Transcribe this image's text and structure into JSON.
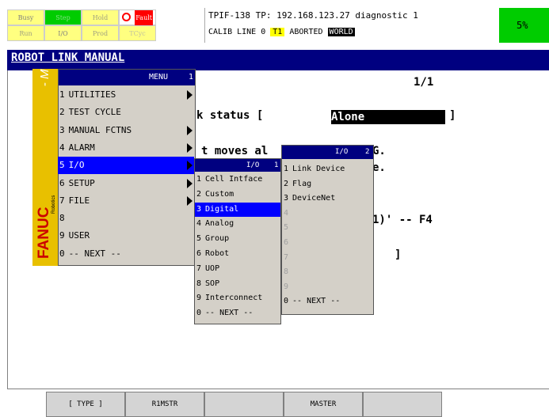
{
  "status_lamps": {
    "busy": "Busy",
    "step": "Step",
    "hold": "Hold",
    "fault": "Fault",
    "run": "Run",
    "io": "I/O",
    "prod": "Prod",
    "tcyc": "TCyc"
  },
  "status_line1": "TPIF-138 TP: 192.168.123.27 diagnostic 1",
  "status_line2": {
    "prefix": "CALIB LINE 0",
    "t1": "T1",
    "aborted": "ABORTED",
    "world": "WORLD"
  },
  "override": "5%",
  "screen_title": "ROBOT LINK MANUAL",
  "page_indicator": "1/1",
  "background_text": {
    "link_status_label": "k status [",
    "link_status_value": "Alone",
    "link_status_close": "]",
    "line2": "t moves al",
    "line2_tail": "G.",
    "line3_tail": "e.",
    "line4": "1)' -- F4",
    "line5": "]"
  },
  "side_brand": {
    "menus_label": "- Menus -",
    "logo": "FANUC",
    "logo_sub": "Robotics"
  },
  "main_menu": {
    "title": "MENU",
    "page": "1",
    "items": [
      {
        "num": "1",
        "label": "UTILITIES",
        "has_sub": true,
        "selected": false
      },
      {
        "num": "2",
        "label": "TEST CYCLE",
        "has_sub": false,
        "selected": false
      },
      {
        "num": "3",
        "label": "MANUAL FCTNS",
        "has_sub": true,
        "selected": false
      },
      {
        "num": "4",
        "label": "ALARM",
        "has_sub": true,
        "selected": false
      },
      {
        "num": "5",
        "label": "I/O",
        "has_sub": true,
        "selected": true
      },
      {
        "num": "6",
        "label": "SETUP",
        "has_sub": true,
        "selected": false
      },
      {
        "num": "7",
        "label": "FILE",
        "has_sub": true,
        "selected": false
      },
      {
        "num": "8",
        "label": "",
        "has_sub": false,
        "selected": false
      },
      {
        "num": "9",
        "label": "USER",
        "has_sub": false,
        "selected": false
      },
      {
        "num": "0",
        "label": "-- NEXT --",
        "has_sub": false,
        "selected": false
      }
    ]
  },
  "io_menu": {
    "title": "I/O",
    "page": "1",
    "items": [
      {
        "num": "1",
        "label": "Cell Intface",
        "selected": false,
        "disabled": false
      },
      {
        "num": "2",
        "label": "Custom",
        "selected": false,
        "disabled": false
      },
      {
        "num": "3",
        "label": "Digital",
        "selected": true,
        "disabled": false
      },
      {
        "num": "4",
        "label": "Analog",
        "selected": false,
        "disabled": false
      },
      {
        "num": "5",
        "label": "Group",
        "selected": false,
        "disabled": false
      },
      {
        "num": "6",
        "label": "Robot",
        "selected": false,
        "disabled": false
      },
      {
        "num": "7",
        "label": "UOP",
        "selected": false,
        "disabled": false
      },
      {
        "num": "8",
        "label": "SOP",
        "selected": false,
        "disabled": false
      },
      {
        "num": "9",
        "label": "Interconnect",
        "selected": false,
        "disabled": false
      },
      {
        "num": "0",
        "label": "-- NEXT --",
        "selected": false,
        "disabled": false
      }
    ]
  },
  "io2_menu": {
    "title": "I/O",
    "page": "2",
    "items": [
      {
        "num": "1",
        "label": "Link Device",
        "disabled": false
      },
      {
        "num": "2",
        "label": "Flag",
        "disabled": false
      },
      {
        "num": "3",
        "label": "DeviceNet",
        "disabled": false
      },
      {
        "num": "4",
        "label": "",
        "disabled": true
      },
      {
        "num": "5",
        "label": "",
        "disabled": true
      },
      {
        "num": "6",
        "label": "",
        "disabled": true
      },
      {
        "num": "7",
        "label": "",
        "disabled": true
      },
      {
        "num": "8",
        "label": "",
        "disabled": true
      },
      {
        "num": "9",
        "label": "",
        "disabled": true
      },
      {
        "num": "0",
        "label": "-- NEXT --",
        "disabled": false
      }
    ]
  },
  "function_keys": [
    "[ TYPE ]",
    "R1MSTR",
    "",
    "MASTER",
    ""
  ],
  "colors": {
    "title_bar": "#000080",
    "menu_bg": "#d4d0c8",
    "selected": "#0000ff",
    "lamp_green": "#00cc00",
    "lamp_yellow": "#ffff00",
    "fault_red": "#ff0000",
    "brand_yellow": "#e8c000",
    "brand_red": "#cc0000"
  }
}
